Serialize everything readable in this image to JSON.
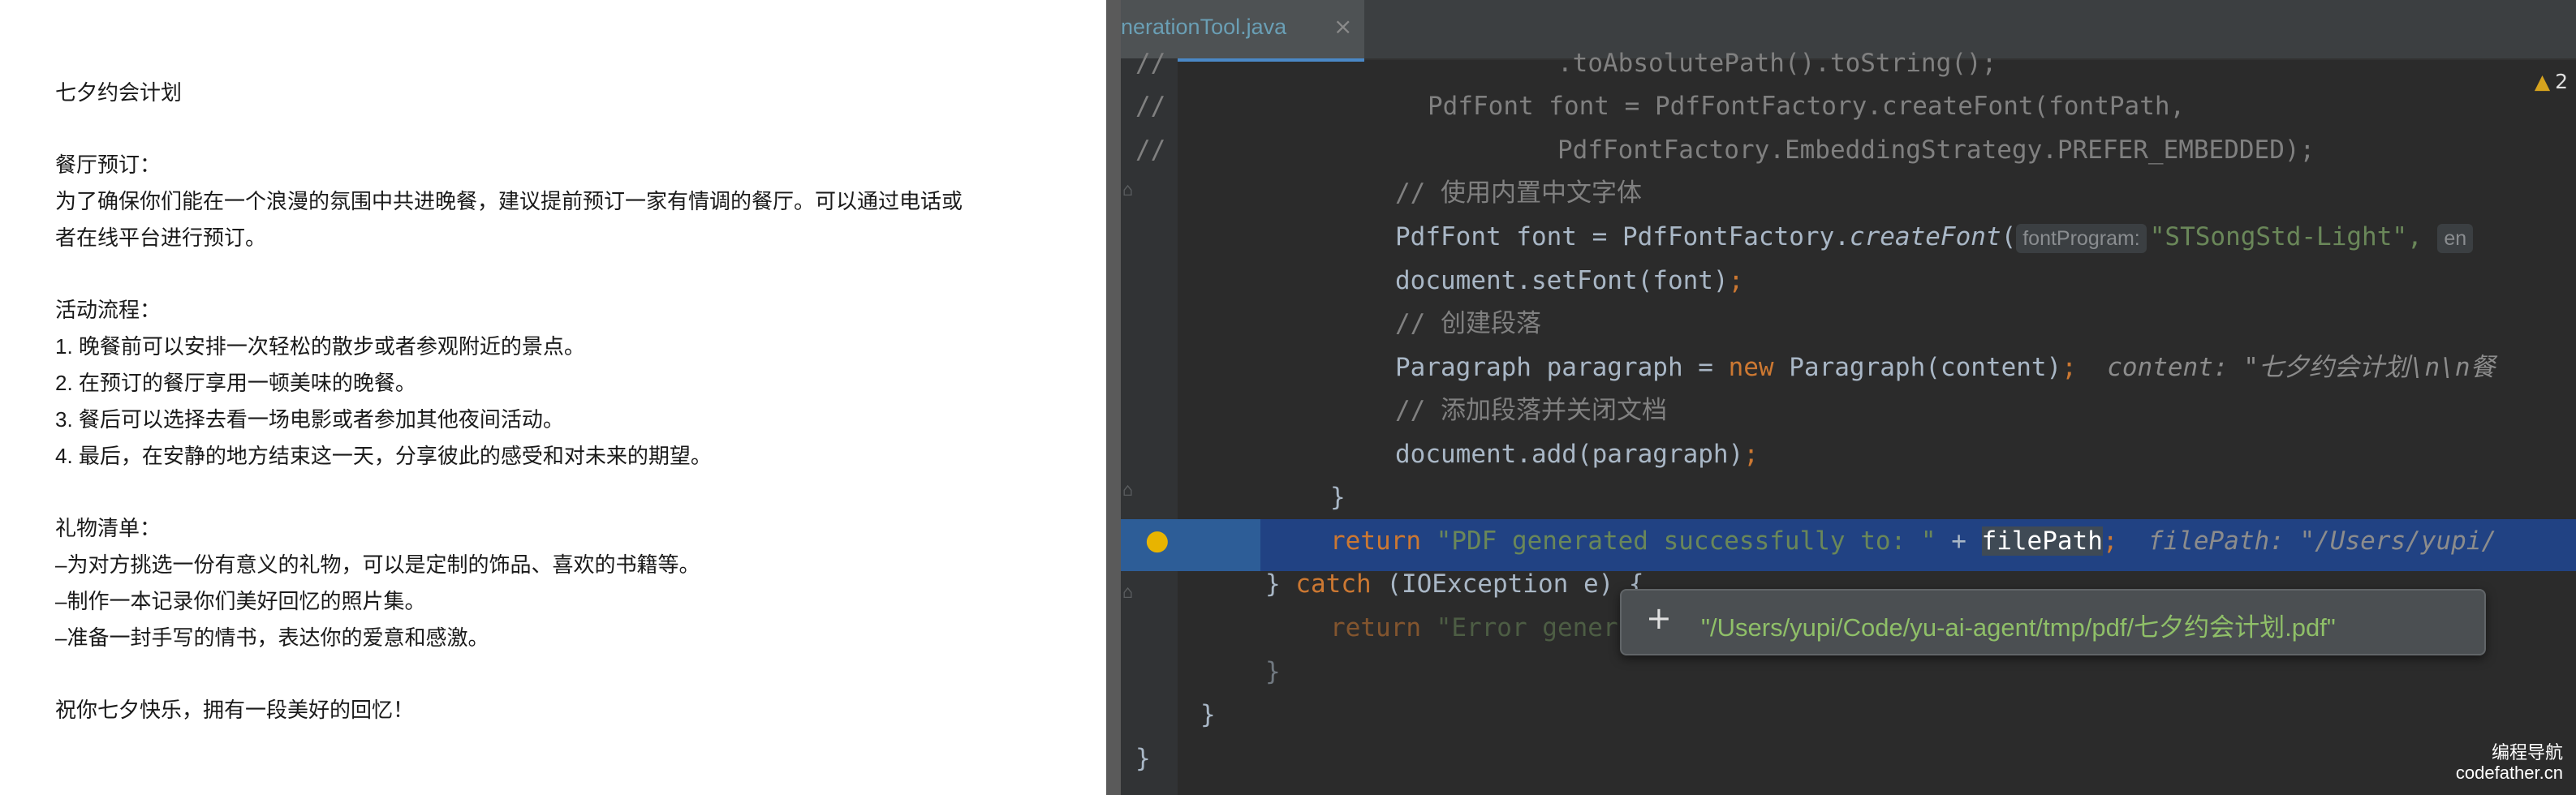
{
  "document": {
    "lines": [
      "七夕约会计划",
      "餐厅预订：",
      "为了确保你们能在一个浪漫的氛围中共进晚餐，建议提前预订一家有情调的餐厅。可以通过电话或",
      "者在线平台进行预订。",
      "活动流程：",
      "1. 晚餐前可以安排一次轻松的散步或者参观附近的景点。",
      "2. 在预订的餐厅享用一顿美味的晚餐。",
      "3. 餐后可以选择去看一场电影或者参加其他夜间活动。",
      "4. 最后，在安静的地方结束这一天，分享彼此的感受和对未来的期望。",
      "礼物清单：",
      "–为对方挑选一份有意义的礼物，可以是定制的饰品、喜欢的书籍等。",
      "–制作一本记录你们美好回忆的照片集。",
      "–准备一封手写的情书，表达你的爱意和感激。",
      "祝你七夕快乐，拥有一段美好的回忆！"
    ]
  },
  "ide": {
    "tab_label": "nerationTool.java",
    "tab_close": "×",
    "warning_count": "2",
    "code": {
      "l1_comment": "//",
      "l1_code": ".toAbsolutePath().toString();",
      "l2_comment": "//",
      "l2_code": "PdfFont font = PdfFontFactory.createFont(fontPath,",
      "l3_comment": "//",
      "l3_code": "PdfFontFactory.EmbeddingStrategy.PREFER_EMBEDDED);",
      "l4": "// 使用内置中文字体",
      "l5_a": "PdfFont font = PdfFontFactory.",
      "l5_b": "createFont",
      "l5_c": "(",
      "l5_hint": "fontProgram:",
      "l5_str": "\"STSongStd-Light\",",
      "l5_hint2": "en",
      "l6_a": "document.setFont(font)",
      "l6_b": ";",
      "l7": "// 创建段落",
      "l8_a": "Paragraph paragraph = ",
      "l8_kw": "new",
      "l8_b": " Paragraph(content)",
      "l8_semi": ";",
      "l8_inline": "content: \"七夕约会计划\\n\\n餐",
      "l9": "// 添加段落并关闭文档",
      "l10_a": "document.add(paragraph)",
      "l10_b": ";",
      "l11": "}",
      "l12_kw": "return",
      "l12_str": "\"PDF generated successfully to: \"",
      "l12_op": " + ",
      "l12_var": "filePath",
      "l12_semi": ";",
      "l12_inline": "filePath: \"/Users/yupi/",
      "l13_a": "} ",
      "l13_kw": "catch",
      "l13_b": " (IOException e) {",
      "l14_kw": "return",
      "l14_str": "\"Error gener",
      "l15": "}",
      "l16": "}",
      "l17": "}"
    },
    "tooltip": {
      "plus": "+",
      "value": "\"/Users/yupi/Code/yu-ai-agent/tmp/pdf/七夕约会计划.pdf\""
    },
    "watermark_line1": "编程导航",
    "watermark_line2": "codefather.cn",
    "colors": {
      "background": "#2b2b2b",
      "keyword": "#cc7832",
      "string": "#6a8759",
      "comment": "#808080",
      "execution_line": "#2d5d97",
      "selection": "#214283"
    }
  }
}
